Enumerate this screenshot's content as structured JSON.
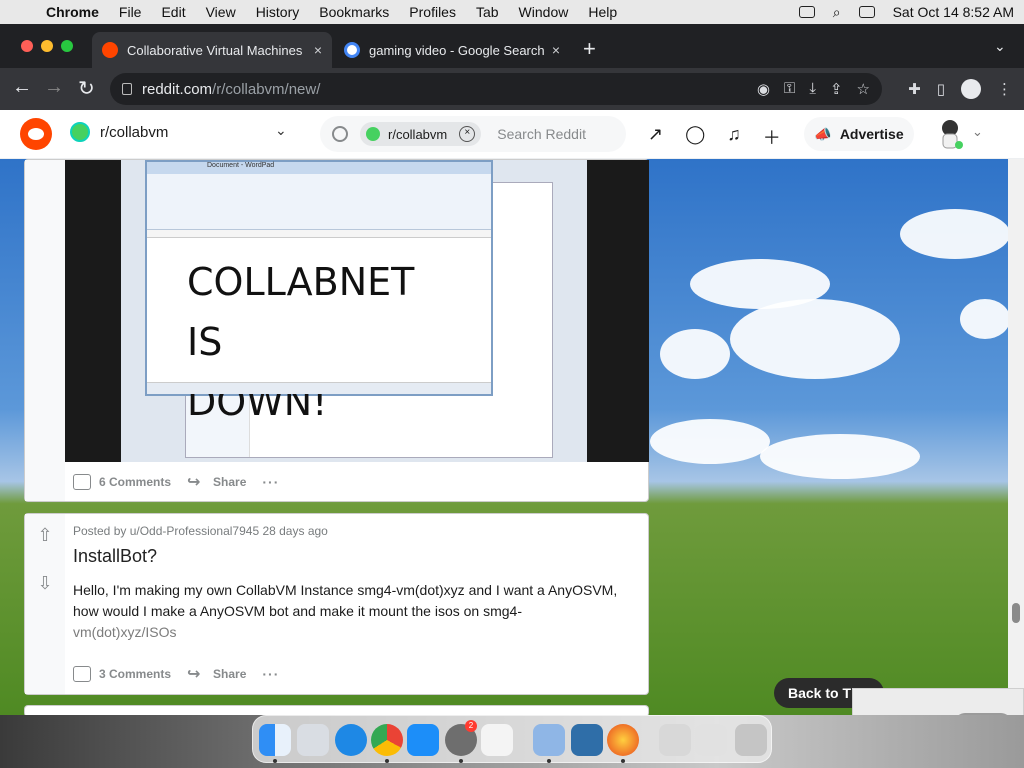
{
  "menubar": {
    "app_name": "Chrome",
    "menus": [
      "File",
      "Edit",
      "View",
      "History",
      "Bookmarks",
      "Profiles",
      "Tab",
      "Window",
      "Help"
    ],
    "clock": "Sat Oct 14  8:52 AM"
  },
  "tabs": [
    {
      "label": "Collaborative Virtual Machines",
      "close": "×"
    },
    {
      "label": "gaming video - Google Search",
      "close": "×"
    }
  ],
  "new_tab": "+",
  "tab_menu": "⌄",
  "toolbar": {
    "back": "←",
    "forward": "→",
    "reload": "↻",
    "url_host": "reddit.com",
    "url_path": "/r/collabvm/new/"
  },
  "reddit": {
    "subreddit": "r/collabvm",
    "search_chip": "r/collabvm",
    "search_placeholder": "Search Reddit",
    "advertise": "Advertise"
  },
  "post1": {
    "image_text_line1": "COLLABNET IS",
    "image_text_line2": "DOWN!",
    "comments": "6 Comments",
    "share": "Share",
    "more": "···"
  },
  "post2": {
    "meta": "Posted by u/Odd-Professional7945 28 days ago",
    "title": "InstallBot?",
    "body": "Hello, I'm making my own CollabVM Instance smg4-vm(dot)xyz and I want a AnyOSVM, how would I make a AnyOSVM bot and make it mount the isos on smg4-",
    "body_fade": "vm(dot)xyz/ISOs",
    "comments": "3 Comments",
    "share": "Share",
    "more": "···"
  },
  "back_to_top": "Back to T",
  "dock_badge": "2"
}
